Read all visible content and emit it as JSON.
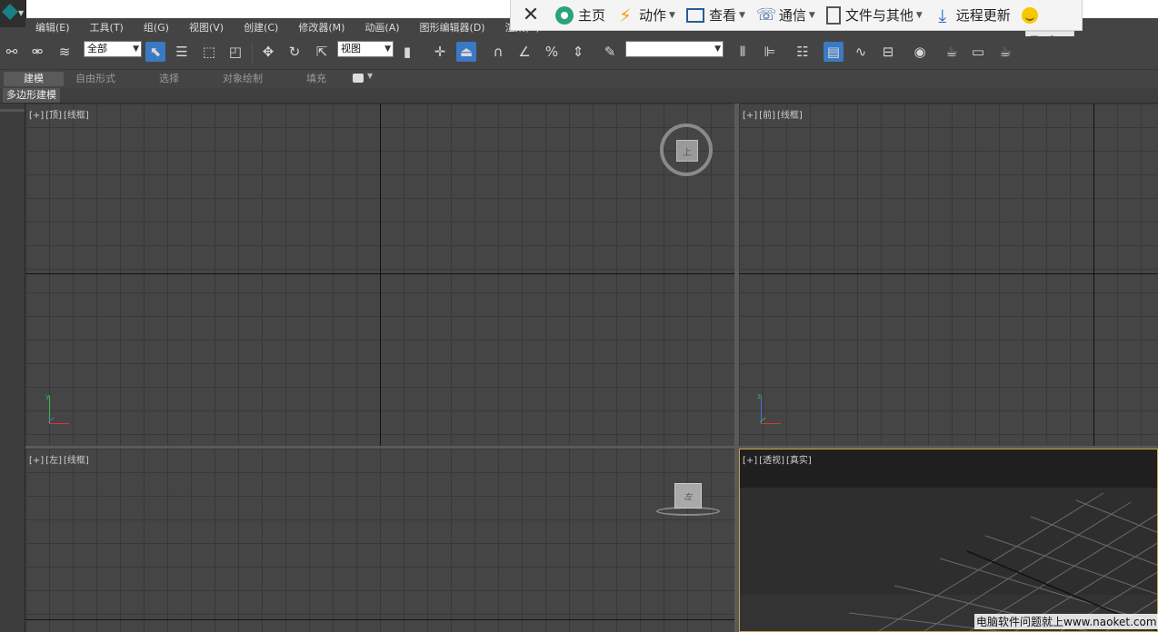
{
  "menu": [
    "编辑(E)",
    "工具(T)",
    "组(G)",
    "视图(V)",
    "创建(C)",
    "修改器(M)",
    "动画(A)",
    "图形编辑器(D)",
    "渲染(R)"
  ],
  "remote_toolbar": {
    "home": "主页",
    "action": "动作",
    "view": "查看",
    "comm": "通信",
    "files": "文件与其他",
    "update": "远程更新"
  },
  "toolbar": {
    "selection_filter": "全部",
    "reference_coord": "视图"
  },
  "ribbon": {
    "tabs": [
      "建模",
      "自由形式",
      "选择",
      "对象绘制",
      "填充"
    ],
    "active_tab": 0,
    "sub_panel": "多边形建模"
  },
  "viewports": {
    "top": {
      "plus": "[+]",
      "name": "[顶]",
      "shading": "[线框]"
    },
    "front": {
      "plus": "[+]",
      "name": "[前]",
      "shading": "[线框]"
    },
    "left": {
      "plus": "[+]",
      "name": "[左]",
      "shading": "[线框]"
    },
    "perspective": {
      "plus": "[+]",
      "name": "[透视]",
      "shading": "[真实]"
    }
  },
  "viewcube": {
    "top_face": "上",
    "left_face": "左"
  },
  "watermark": "电脑软件问题就上www.naoket.com",
  "colors": {
    "accent_active": "#3a79c4",
    "viewport_bg": "#454545",
    "active_viewport_border": "#c8a24a"
  }
}
